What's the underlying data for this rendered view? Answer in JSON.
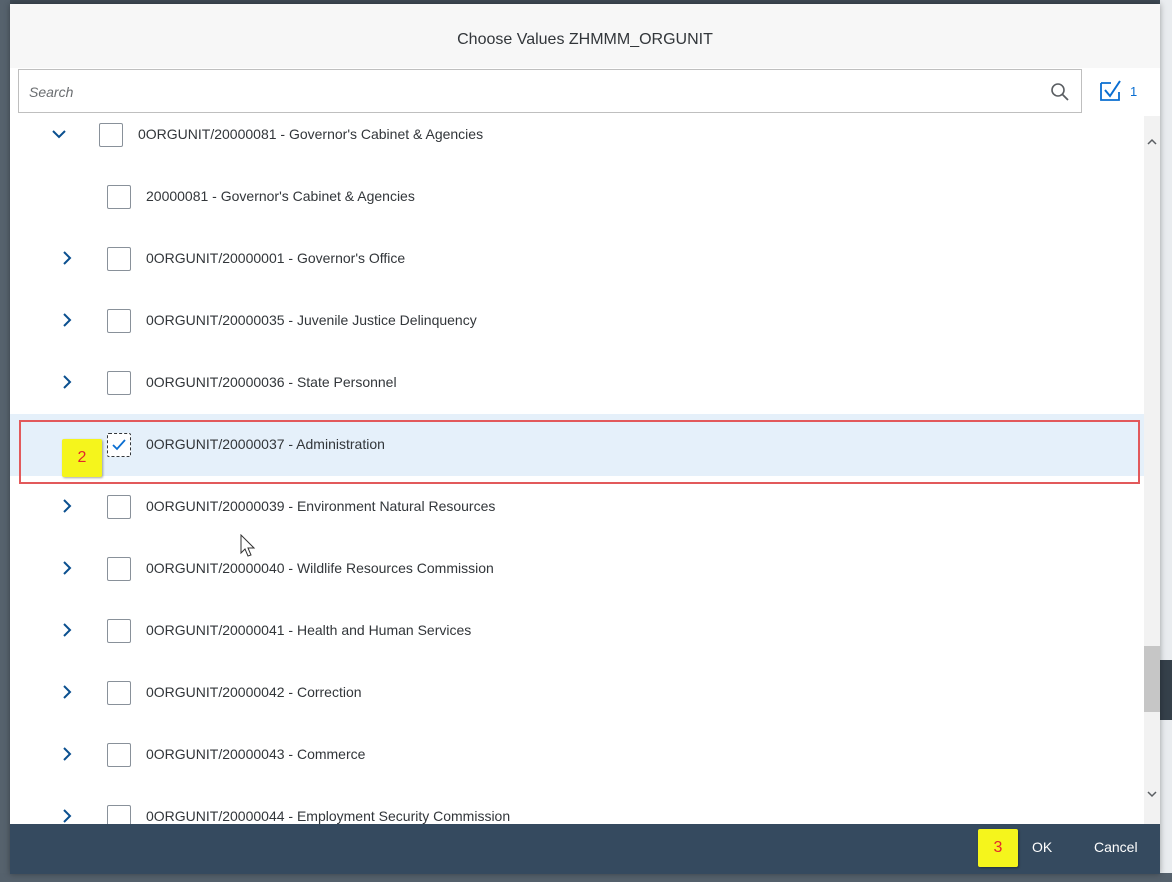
{
  "dialog": {
    "title": "Choose Values ZHMMM_ORGUNIT"
  },
  "search": {
    "placeholder": "Search",
    "value": ""
  },
  "select_all": {
    "icon": "checklist-icon",
    "count": "1"
  },
  "items": [
    {
      "label": "0ORGUNIT/20000081 - Governor's Cabinet & Agencies",
      "expand": "expanded",
      "checked": false,
      "level": 0
    },
    {
      "label": "20000081 - Governor's Cabinet & Agencies",
      "expand": "none",
      "checked": false,
      "level": 1
    },
    {
      "label": "0ORGUNIT/20000001 - Governor's Office",
      "expand": "collapsed",
      "checked": false,
      "level": 1
    },
    {
      "label": "0ORGUNIT/20000035 - Juvenile Justice Delinquency",
      "expand": "collapsed",
      "checked": false,
      "level": 1
    },
    {
      "label": "0ORGUNIT/20000036 - State Personnel",
      "expand": "collapsed",
      "checked": false,
      "level": 1
    },
    {
      "label": "0ORGUNIT/20000037 - Administration",
      "expand": "none",
      "checked": true,
      "level": 1,
      "selected": true
    },
    {
      "label": "0ORGUNIT/20000039 - Environment Natural Resources",
      "expand": "collapsed",
      "checked": false,
      "level": 1
    },
    {
      "label": "0ORGUNIT/20000040 - Wildlife Resources Commission",
      "expand": "collapsed",
      "checked": false,
      "level": 1
    },
    {
      "label": "0ORGUNIT/20000041 - Health and Human Services",
      "expand": "collapsed",
      "checked": false,
      "level": 1
    },
    {
      "label": "0ORGUNIT/20000042 - Correction",
      "expand": "collapsed",
      "checked": false,
      "level": 1
    },
    {
      "label": "0ORGUNIT/20000043 - Commerce",
      "expand": "collapsed",
      "checked": false,
      "level": 1
    },
    {
      "label": "0ORGUNIT/20000044 - Employment Security Commission",
      "expand": "collapsed",
      "checked": false,
      "level": 1
    }
  ],
  "annotations": {
    "step2": "2",
    "step3": "3"
  },
  "footer": {
    "ok_label": "OK",
    "cancel_label": "Cancel"
  },
  "colors": {
    "accent": "#0a6ed1",
    "footer_bg": "#354a5f",
    "selected_row": "#e5f0fa",
    "highlight_border": "#e2595b",
    "badge_bg": "#f5f51c",
    "badge_text": "#e2272c"
  }
}
